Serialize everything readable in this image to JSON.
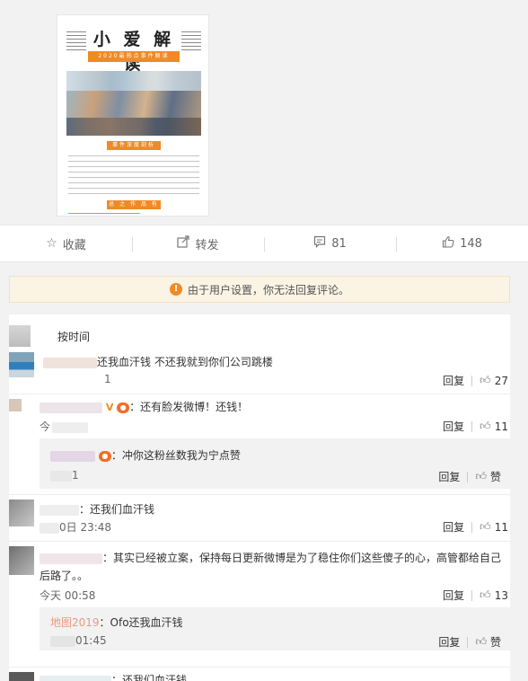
{
  "post_image": {
    "title": "小 爱 解 读",
    "subtitle": "2020最热点事件解读",
    "section_tag": "事件深度剖析",
    "section_tag2": "总 之 作 品 有 误"
  },
  "actions": {
    "favorite_label": "收藏",
    "repost_label": "转发",
    "comment_count": "81",
    "like_count": "148"
  },
  "notice": {
    "text": "由于用户设置，你无法回复评论。"
  },
  "comments_sort": {
    "label": "按时间"
  },
  "comments": [
    {
      "text": "还我血汗钱 不还我就到你们公司跳楼",
      "time": "1",
      "reply_label": "回复",
      "likes": "27"
    },
    {
      "text": "：还有脸发微博！还钱！",
      "time": "今",
      "reply_label": "回复",
      "likes": "11",
      "reply": {
        "text": "：冲你这粉丝数我为宁点赞",
        "time": "1",
        "reply_label": "回复",
        "likes": "赞"
      }
    },
    {
      "text": "：还我们血汗钱",
      "time": "0日 23:48",
      "reply_label": "回复",
      "likes": "11"
    },
    {
      "text_line1": "：其实已经被立案，保持每日更新微博是为了稳住你们这些傻子的心，高管都给自己",
      "text_line2": "后路了。。",
      "time": "今天 00:58",
      "reply_label": "回复",
      "likes": "13",
      "reply": {
        "name": "地图2019",
        "text": "：Ofo还我血汗钱",
        "time": "01:45",
        "reply_label": "回复",
        "likes": "赞"
      }
    },
    {
      "text": "：还我们血汗钱"
    }
  ],
  "colors": {
    "accent": "#f08a24",
    "notice_bg": "#fbf3e4"
  }
}
